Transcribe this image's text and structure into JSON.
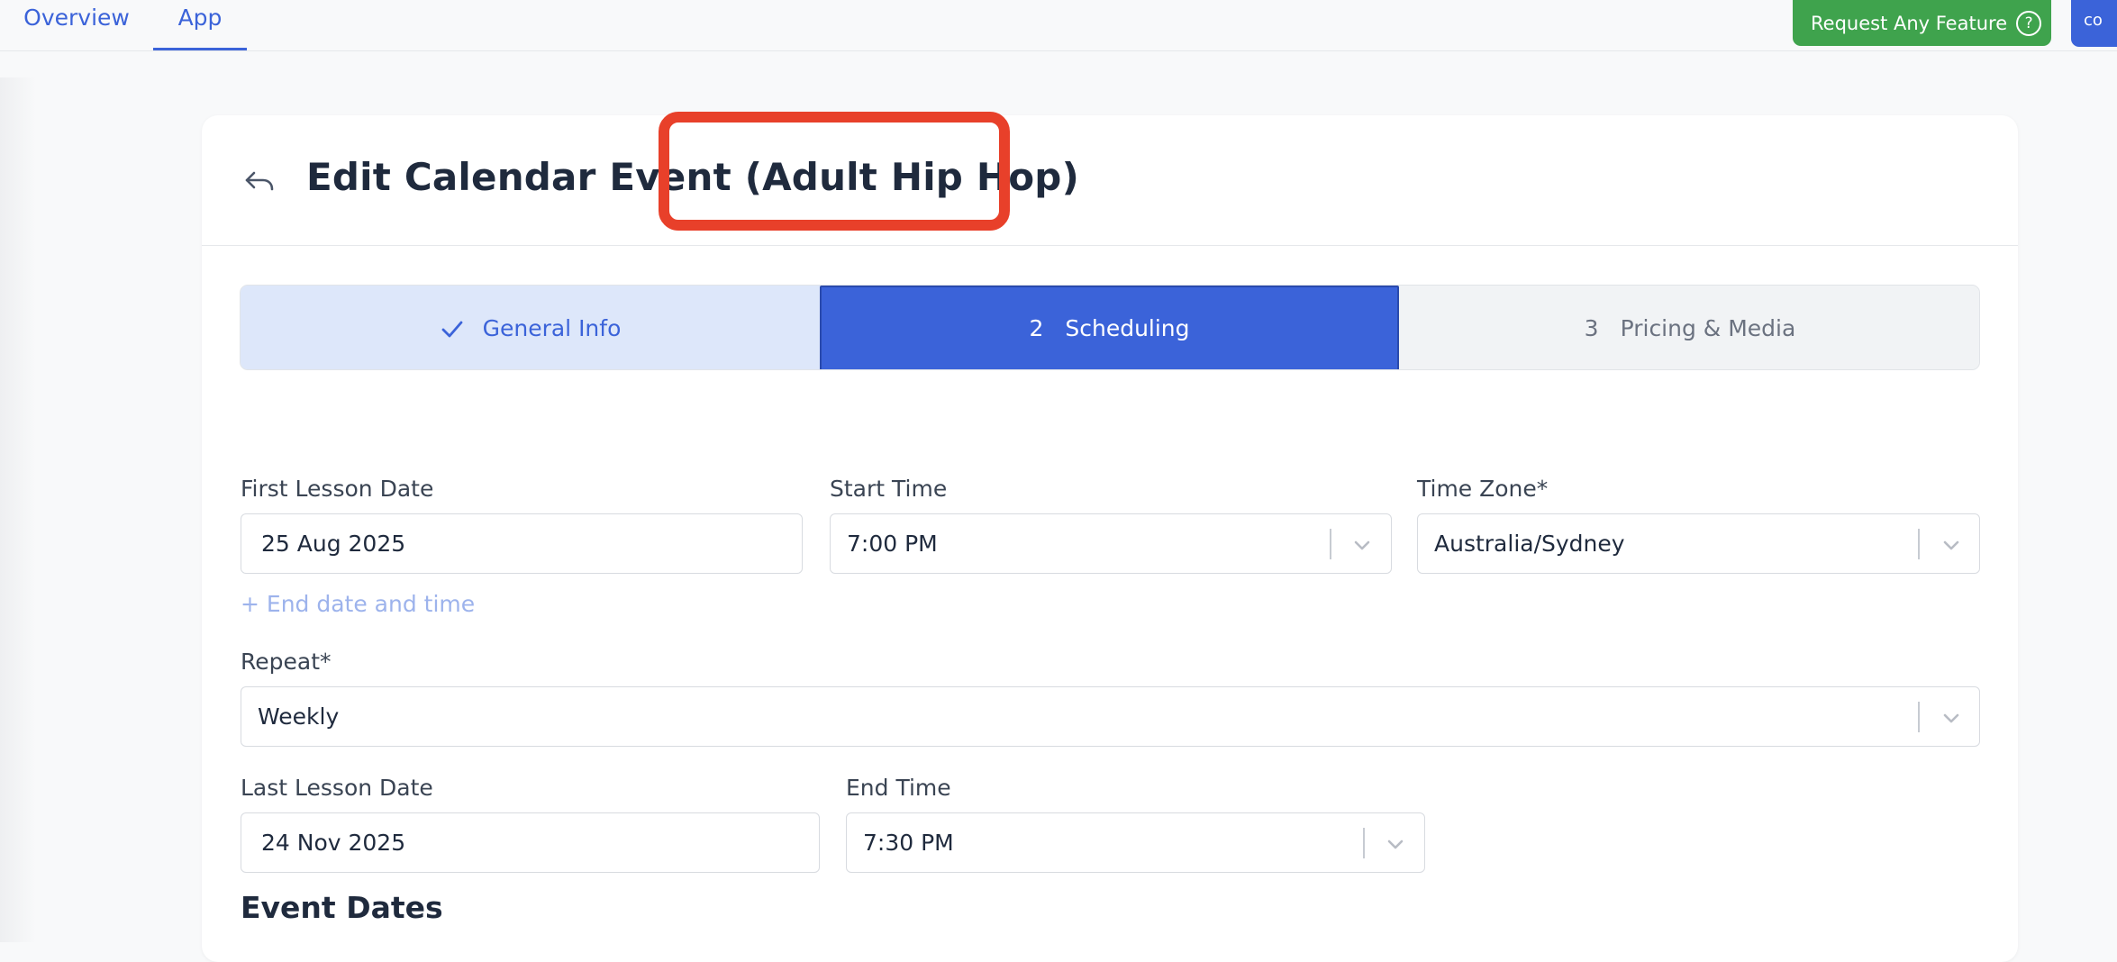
{
  "nav": {
    "tabs": [
      {
        "label": "Overview"
      },
      {
        "label": "App"
      }
    ]
  },
  "header_actions": {
    "request_feature": "Request Any Feature",
    "help_glyph": "?",
    "edge_button": "co"
  },
  "page": {
    "title_prefix": "Edit Calendar Event",
    "title_name": "(Adult Hip Hop)"
  },
  "steps": [
    {
      "number": "✓",
      "label": "General Info",
      "state": "completed"
    },
    {
      "number": "2",
      "label": "Scheduling",
      "state": "active"
    },
    {
      "number": "3",
      "label": "Pricing & Media",
      "state": "upcoming"
    }
  ],
  "form": {
    "first_lesson_date": {
      "label": "First Lesson Date",
      "value": "25 Aug 2025"
    },
    "start_time": {
      "label": "Start Time",
      "value": "7:00 PM"
    },
    "time_zone": {
      "label": "Time Zone*",
      "value": "Australia/Sydney"
    },
    "end_date_link": "+ End date and time",
    "repeat": {
      "label": "Repeat*",
      "value": "Weekly"
    },
    "last_lesson_date": {
      "label": "Last Lesson Date",
      "value": "24 Nov 2025"
    },
    "end_time": {
      "label": "End Time",
      "value": "7:30 PM"
    }
  },
  "sections": {
    "event_dates": "Event Dates"
  },
  "colors": {
    "accent": "#3b63d9",
    "success": "#3fa34d",
    "highlight": "#e8402a"
  }
}
